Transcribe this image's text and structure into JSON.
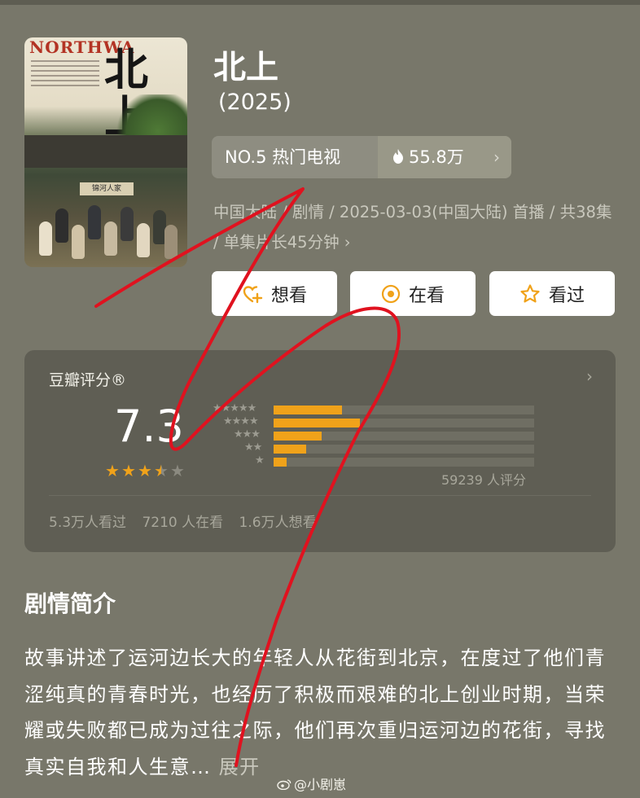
{
  "poster": {
    "title_en": "NORTHWA",
    "title_cn": "北上",
    "sign": "锦河人家"
  },
  "show": {
    "title": "北上",
    "year": "(2025)"
  },
  "ranking": {
    "label": "NO.5 热门电视",
    "heat": "55.8万",
    "heat_icon": "fire-icon"
  },
  "meta": {
    "text": "中国大陆 / 剧情 / 2025-03-03(中国大陆) 首播 / 共38集 / 单集片长45分钟",
    "more": "›"
  },
  "actions": {
    "want": "想看",
    "watching": "在看",
    "watched": "看过"
  },
  "rating": {
    "title": "豆瓣评分®",
    "score": "7.3",
    "stars": 3.5,
    "distribution_pct": [
      27,
      34,
      19,
      13,
      5
    ],
    "count": "59239 人评分",
    "watched": "5.3万人看过",
    "watching": "7210 人在看",
    "want": "1.6万人想看"
  },
  "synopsis": {
    "heading": "剧情简介",
    "text": "故事讲述了运河边长大的年轻人从花街到北京，在度过了他们青涩纯真的青春时光，也经历了积极而艰难的北上创业时期，当荣耀或失败都已成为过往之际，他们再次重归运河边的花街，寻找真实自我和人生意…",
    "expand": "展开"
  },
  "watermark": "@小剧崽",
  "colors": {
    "background": "#78776a",
    "card": "#5f5e54",
    "accent_star": "#f0a21a",
    "scribble": "#e0121f"
  }
}
